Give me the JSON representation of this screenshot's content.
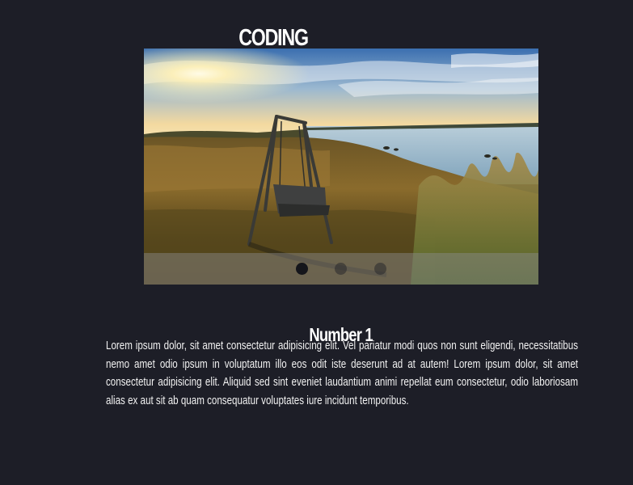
{
  "page": {
    "title": "CODING",
    "background": "#1d1e27"
  },
  "slider": {
    "image_alt": "swing by the lake at sunset",
    "dots": [
      {
        "label": "slide 1",
        "active": true
      },
      {
        "label": "slide 2",
        "active": false
      },
      {
        "label": "slide 3",
        "active": false
      }
    ]
  },
  "slide": {
    "heading": "Number 1",
    "text": "Lorem ipsum dolor, sit amet consectetur adipisicing elit. Vel pariatur modi quos non sunt eligendi, necessitatibus nemo amet odio ipsum in voluptatum illo eos odit iste deserunt ad at autem! Lorem ipsum dolor, sit amet consectetur adipisicing elit. Aliquid sed sint eveniet laudantium animi repellat eum consectetur, odio laboriosam alias ex aut sit ab quam consequatur voluptates iure incidunt temporibus."
  }
}
